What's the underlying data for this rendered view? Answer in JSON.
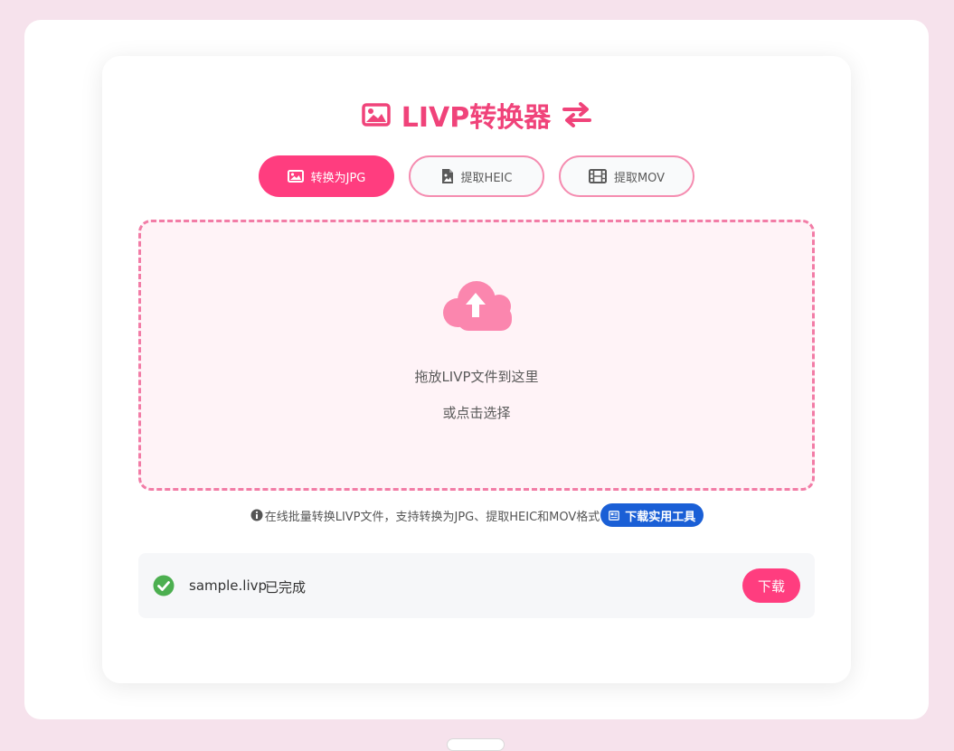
{
  "app": {
    "title": "LIVP转换器"
  },
  "tabs": [
    {
      "label": "转换为JPG",
      "icon": "image-icon",
      "active": true
    },
    {
      "label": "提取HEIC",
      "icon": "file-image-icon",
      "active": false
    },
    {
      "label": "提取MOV",
      "icon": "film-icon",
      "active": false
    }
  ],
  "dropzone": {
    "icon": "cloud-upload-icon",
    "main_text": "拖放LIVP文件到这里",
    "sub_text": "或点击选择"
  },
  "info": {
    "icon": "info-circle-icon",
    "text": "在线批量转换LIVP文件，支持转换为JPG、提取HEIC和MOV格式",
    "tool_button": "下载实用工具"
  },
  "files": [
    {
      "name": "sample.livp",
      "status": "已完成",
      "download_label": "下载"
    }
  ],
  "colors": {
    "accent": "#ff3d7f",
    "title": "#f0437a",
    "dropzone_border": "#f27ca6",
    "dropzone_bg": "#fff3f7",
    "tool_button": "#1a5fd6",
    "success": "#4caf50",
    "page_bg": "#f6e2ec"
  }
}
